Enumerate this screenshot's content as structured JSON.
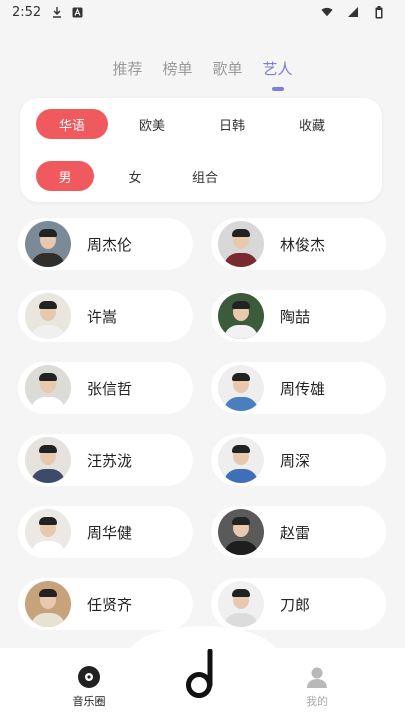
{
  "status_bar": {
    "time": "2:52",
    "left_icons": [
      "download-icon",
      "text-a-icon"
    ],
    "right_icons": [
      "wifi-icon",
      "signal-icon",
      "battery-icon"
    ]
  },
  "tabs": [
    {
      "label": "推荐",
      "active": false
    },
    {
      "label": "榜单",
      "active": false
    },
    {
      "label": "歌单",
      "active": false
    },
    {
      "label": "艺人",
      "active": true
    }
  ],
  "filters": {
    "region": [
      {
        "label": "华语",
        "selected": true
      },
      {
        "label": "欧美",
        "selected": false
      },
      {
        "label": "日韩",
        "selected": false
      },
      {
        "label": "收藏",
        "selected": false
      }
    ],
    "gender": [
      {
        "label": "男",
        "selected": true
      },
      {
        "label": "女",
        "selected": false
      },
      {
        "label": "组合",
        "selected": false
      }
    ]
  },
  "artists": [
    {
      "name": "周杰伦",
      "avatar_bg": "#7a8a96",
      "shirt": "#2f2f2f"
    },
    {
      "name": "林俊杰",
      "avatar_bg": "#d8d8d8",
      "shirt": "#7a2a2e"
    },
    {
      "name": "许嵩",
      "avatar_bg": "#e9e6e0",
      "shirt": "#f0f0f0"
    },
    {
      "name": "陶喆",
      "avatar_bg": "#3c5b3a",
      "shirt": "#f2f2f2"
    },
    {
      "name": "张信哲",
      "avatar_bg": "#dddbd6",
      "shirt": "#ffffff"
    },
    {
      "name": "周传雄",
      "avatar_bg": "#eeeeee",
      "shirt": "#4a7fbf"
    },
    {
      "name": "汪苏泷",
      "avatar_bg": "#e6e3de",
      "shirt": "#3d4a6a"
    },
    {
      "name": "周深",
      "avatar_bg": "#eeeeee",
      "shirt": "#3f6fb7"
    },
    {
      "name": "周华健",
      "avatar_bg": "#ece9e4",
      "shirt": "#ffffff"
    },
    {
      "name": "赵雷",
      "avatar_bg": "#5a5a5a",
      "shirt": "#1e1e1e"
    },
    {
      "name": "任贤齐",
      "avatar_bg": "#c7a27a",
      "shirt": "#e8e2d4"
    },
    {
      "name": "刀郎",
      "avatar_bg": "#f0f0f0",
      "shirt": "#dcdcdc"
    }
  ],
  "bottom_nav": {
    "left_label": "音乐圈",
    "right_label": "我的"
  },
  "colors": {
    "accent": "#7b7fd8",
    "chip_selected": "#f05a5f",
    "background": "#f5f5f5"
  }
}
